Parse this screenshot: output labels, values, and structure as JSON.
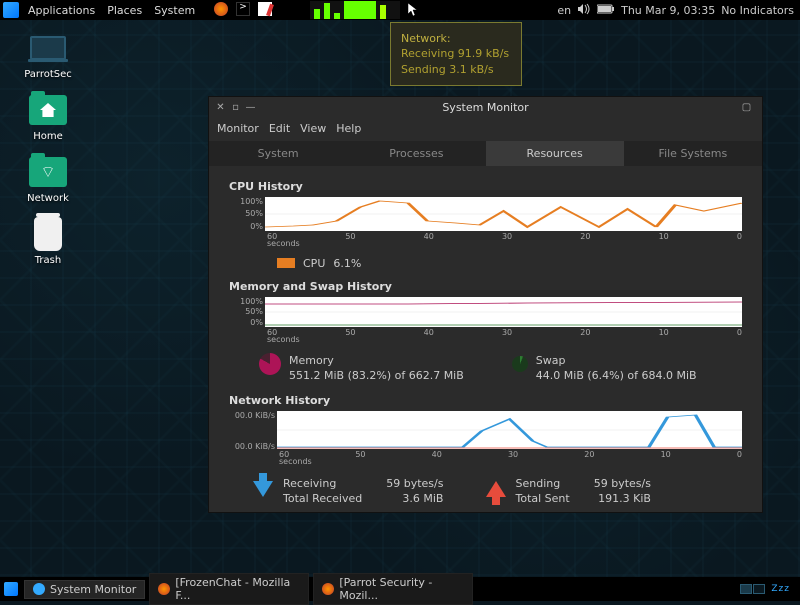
{
  "panel": {
    "menus": [
      "Applications",
      "Places",
      "System"
    ],
    "lang": "en",
    "clock": "Thu Mar  9, 03:35",
    "indicators": "No Indicators"
  },
  "tooltip": {
    "title": "Network:",
    "rx": "Receiving 91.9 kB/s",
    "tx": "Sending 3.1 kB/s"
  },
  "desktop_icons": [
    {
      "name": "parrotsec",
      "label": "ParrotSec",
      "kind": "laptop"
    },
    {
      "name": "home",
      "label": "Home",
      "kind": "folder-home"
    },
    {
      "name": "network",
      "label": "Network",
      "kind": "folder-net"
    },
    {
      "name": "trash",
      "label": "Trash",
      "kind": "trash"
    }
  ],
  "window": {
    "title": "System Monitor",
    "menus": [
      "Monitor",
      "Edit",
      "View",
      "Help"
    ],
    "tabs": [
      "System",
      "Processes",
      "Resources",
      "File Systems"
    ],
    "active_tab": 2,
    "cpu": {
      "title": "CPU History",
      "y": [
        "100%",
        "50%",
        "0%"
      ],
      "x": [
        "60",
        "50",
        "40",
        "30",
        "20",
        "10",
        "0"
      ],
      "x_unit": "seconds",
      "legend_label": "CPU",
      "legend_val": "6.1%"
    },
    "mem": {
      "title": "Memory and Swap History",
      "y": [
        "100%",
        "50%",
        "0%"
      ],
      "x": [
        "60",
        "50",
        "40",
        "30",
        "20",
        "10",
        "0"
      ],
      "x_unit": "seconds",
      "memory_label": "Memory",
      "memory_val": "551.2 MiB (83.2%) of 662.7 MiB",
      "swap_label": "Swap",
      "swap_val": "44.0 MiB (6.4%) of 684.0 MiB"
    },
    "net": {
      "title": "Network History",
      "y": [
        "00.0 KiB/s",
        "00.0 KiB/s"
      ],
      "x": [
        "60",
        "50",
        "40",
        "30",
        "20",
        "10",
        "0"
      ],
      "x_unit": "seconds",
      "rx_label": "Receiving",
      "rx_rate": "59 bytes/s",
      "rx_total_label": "Total Received",
      "rx_total": "3.6 MiB",
      "tx_label": "Sending",
      "tx_rate": "59 bytes/s",
      "tx_total_label": "Total Sent",
      "tx_total": "191.3 KiB"
    }
  },
  "taskbar": {
    "tasks": [
      {
        "label": "System Monitor",
        "active": true,
        "color": "#3af"
      },
      {
        "label": "[FrozenChat - Mozilla F...",
        "active": false,
        "color": "#e74c3c"
      },
      {
        "label": "[Parrot Security - Mozil...",
        "active": false,
        "color": "#e74c3c"
      }
    ],
    "sleep": "Zzz"
  },
  "chart_data": [
    {
      "type": "line",
      "title": "CPU History",
      "xlabel": "seconds",
      "ylabel": "%",
      "ylim": [
        0,
        100
      ],
      "x": [
        60,
        55,
        50,
        45,
        40,
        35,
        30,
        25,
        20,
        15,
        10,
        5,
        0
      ],
      "series": [
        {
          "name": "CPU",
          "color": "#e67e22",
          "values": [
            10,
            12,
            15,
            55,
            60,
            25,
            20,
            15,
            40,
            10,
            50,
            45,
            60
          ]
        }
      ]
    },
    {
      "type": "line",
      "title": "Memory and Swap History",
      "xlabel": "seconds",
      "ylabel": "%",
      "ylim": [
        0,
        100
      ],
      "x": [
        60,
        50,
        40,
        30,
        20,
        10,
        0
      ],
      "series": [
        {
          "name": "Memory",
          "color": "#ad1457",
          "values": [
            80,
            80,
            81,
            82,
            82,
            83,
            83
          ]
        },
        {
          "name": "Swap",
          "color": "#2e7d32",
          "values": [
            6,
            6,
            6,
            6,
            6,
            6,
            6
          ]
        }
      ]
    },
    {
      "type": "line",
      "title": "Network History",
      "xlabel": "seconds",
      "ylabel": "KiB/s",
      "x": [
        60,
        55,
        50,
        45,
        40,
        35,
        30,
        25,
        20,
        15,
        10,
        5,
        0
      ],
      "series": [
        {
          "name": "Receiving",
          "color": "#3498db",
          "values": [
            0,
            0,
            0,
            0,
            0,
            0,
            40,
            70,
            10,
            0,
            0,
            70,
            80
          ]
        },
        {
          "name": "Sending",
          "color": "#e74c3c",
          "values": [
            0,
            0,
            0,
            0,
            0,
            0,
            2,
            3,
            1,
            0,
            0,
            3,
            4
          ]
        }
      ]
    }
  ]
}
